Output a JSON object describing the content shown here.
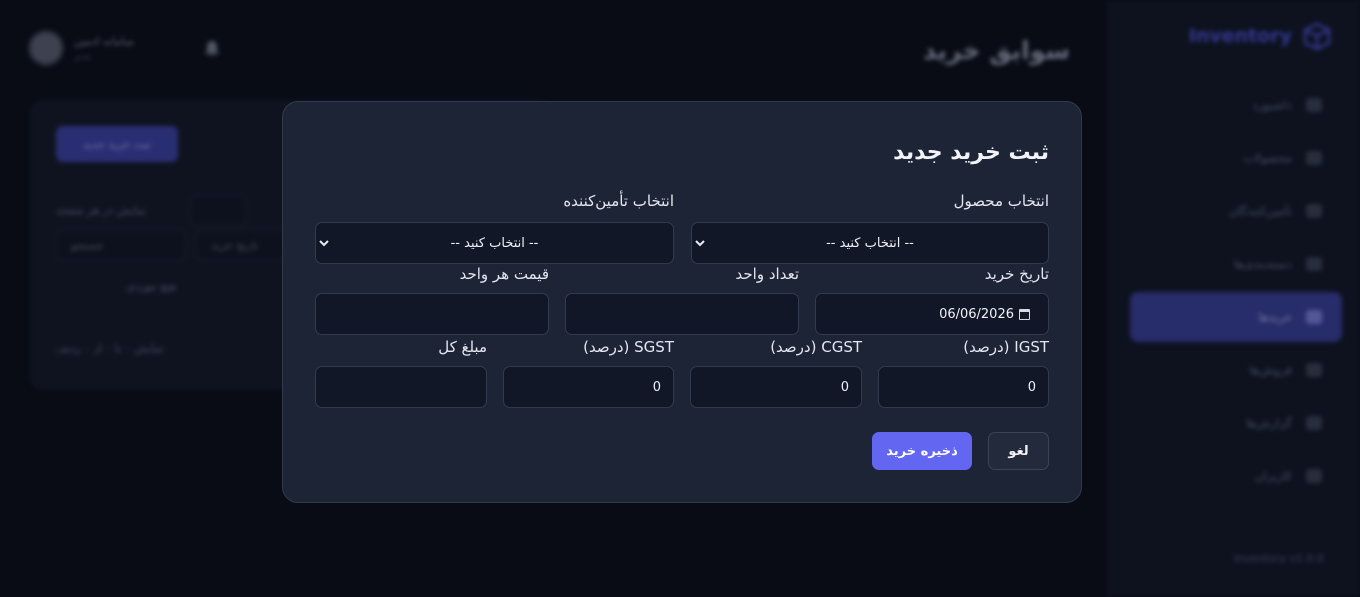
{
  "background": {
    "brand": {
      "name": "Inventory"
    },
    "page_title": "سوابق خرید",
    "user": {
      "name": "سامانه ادمین",
      "role": "مدیر"
    },
    "nav_items": [
      {
        "label": "داشبورد",
        "active": false
      },
      {
        "label": "محصولات",
        "active": false
      },
      {
        "label": "تأمین‌کنندگان",
        "active": false
      },
      {
        "label": "دسته‌بندی‌ها",
        "active": false
      },
      {
        "label": "خریدها",
        "active": true
      },
      {
        "label": "فروش‌ها",
        "active": false
      },
      {
        "label": "گزارش‌ها",
        "active": false
      },
      {
        "label": "کاربران",
        "active": false
      }
    ],
    "add_button": "ثبت خرید جدید",
    "version": "Inventory v1.0.0",
    "panel_texts": {
      "per_page": "نمایش در هر صفحه",
      "search": "جستجو",
      "date_filter": "تاریخ خرید",
      "empty": "هیچ موردی",
      "summary": "نمایش ۰ تا ۰ از ۰ ردیف"
    }
  },
  "modal": {
    "title": "ثبت خرید جدید",
    "product": {
      "label": "انتخاب محصول",
      "value": "-- انتخاب کنید --"
    },
    "supplier": {
      "label": "انتخاب تأمین‌کننده",
      "value": "-- انتخاب کنید --"
    },
    "purchase_date": {
      "label": "تاریخ خرید",
      "value": "06/06/2026"
    },
    "quantity": {
      "label": "تعداد واحد",
      "value": ""
    },
    "unit_price": {
      "label": "قیمت هر واحد",
      "value": ""
    },
    "igst": {
      "label": "IGST (درصد)",
      "value": "0"
    },
    "cgst": {
      "label": "CGST (درصد)",
      "value": "0"
    },
    "sgst": {
      "label": "SGST (درصد)",
      "value": "0"
    },
    "total": {
      "label": "مبلغ کل",
      "value": ""
    },
    "cancel_label": "لغو",
    "save_label": "ذخیره خرید"
  },
  "colors": {
    "accent": "#6366f1",
    "modal_bg": "#1d2435",
    "page_bg": "#0b0e18"
  }
}
